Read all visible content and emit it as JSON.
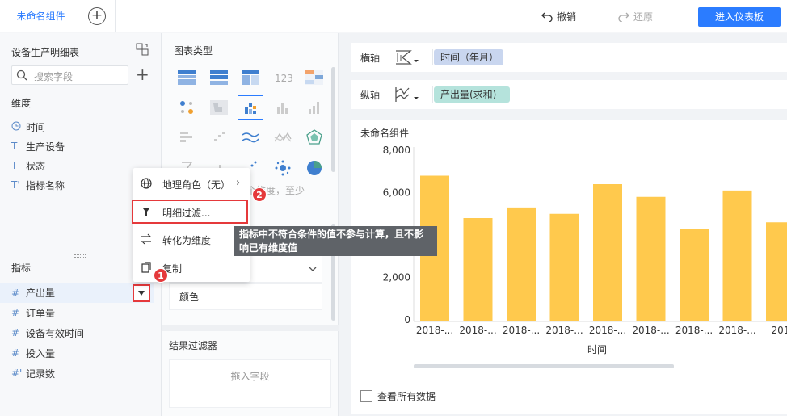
{
  "topbar": {
    "tab_label": "未命名组件",
    "undo_label": "撤销",
    "redo_label": "还原",
    "enter_label": "进入仪表板"
  },
  "left": {
    "dataset_title": "设备生产明细表",
    "search_placeholder": "搜索字段",
    "dimension_label": "维度",
    "dimensions": [
      {
        "icon": "clock-icon",
        "label": "时间"
      },
      {
        "icon": "text-t-icon",
        "label": "生产设备"
      },
      {
        "icon": "text-t-icon",
        "label": "状态"
      },
      {
        "icon": "text-t-icon",
        "label": "指标名称"
      }
    ],
    "measure_label": "指标",
    "measures": [
      {
        "label": "产出量"
      },
      {
        "label": "订单量"
      },
      {
        "label": "设备有效时间"
      },
      {
        "label": "投入量"
      },
      {
        "label": "记录数"
      }
    ]
  },
  "middle": {
    "chart_type_title": "图表类型",
    "hint_text": "个维度，至少",
    "color_label": "颜色",
    "result_filter_title": "结果过滤器",
    "drop_hint": "拖入字段"
  },
  "right": {
    "x_axis_label": "横轴",
    "x_axis_field": "时间（年月）",
    "y_axis_label": "纵轴",
    "y_axis_field": "产出量(求和)",
    "chart_title": "未命名组件",
    "view_all_label": "查看所有数据"
  },
  "menu": {
    "items": [
      {
        "label": "地理角色（无）"
      },
      {
        "label": "明细过滤..."
      },
      {
        "label": "转化为维度"
      },
      {
        "label": "复制"
      }
    ],
    "badge1": "1",
    "badge2": "2",
    "tooltip": "指标中不符合条件的值不参与计算，且不影响已有维度值"
  },
  "colors": {
    "accent": "#2b7cff",
    "bar": "#ffc94d",
    "highlight_red": "#e5393b"
  },
  "chart_data": {
    "type": "bar",
    "categories": [
      "2018-...",
      "2018-...",
      "2018-...",
      "2018-...",
      "2018-...",
      "2018-...",
      "2018-...",
      "2018-...",
      "201"
    ],
    "values": [
      6800,
      4800,
      5300,
      5000,
      6400,
      5800,
      4300,
      6100,
      4600
    ],
    "xlabel": "时间",
    "ylabel": "",
    "yticks": [
      "0",
      "2,000",
      "6,000",
      "8,000"
    ],
    "ylim": [
      0,
      8000
    ]
  }
}
